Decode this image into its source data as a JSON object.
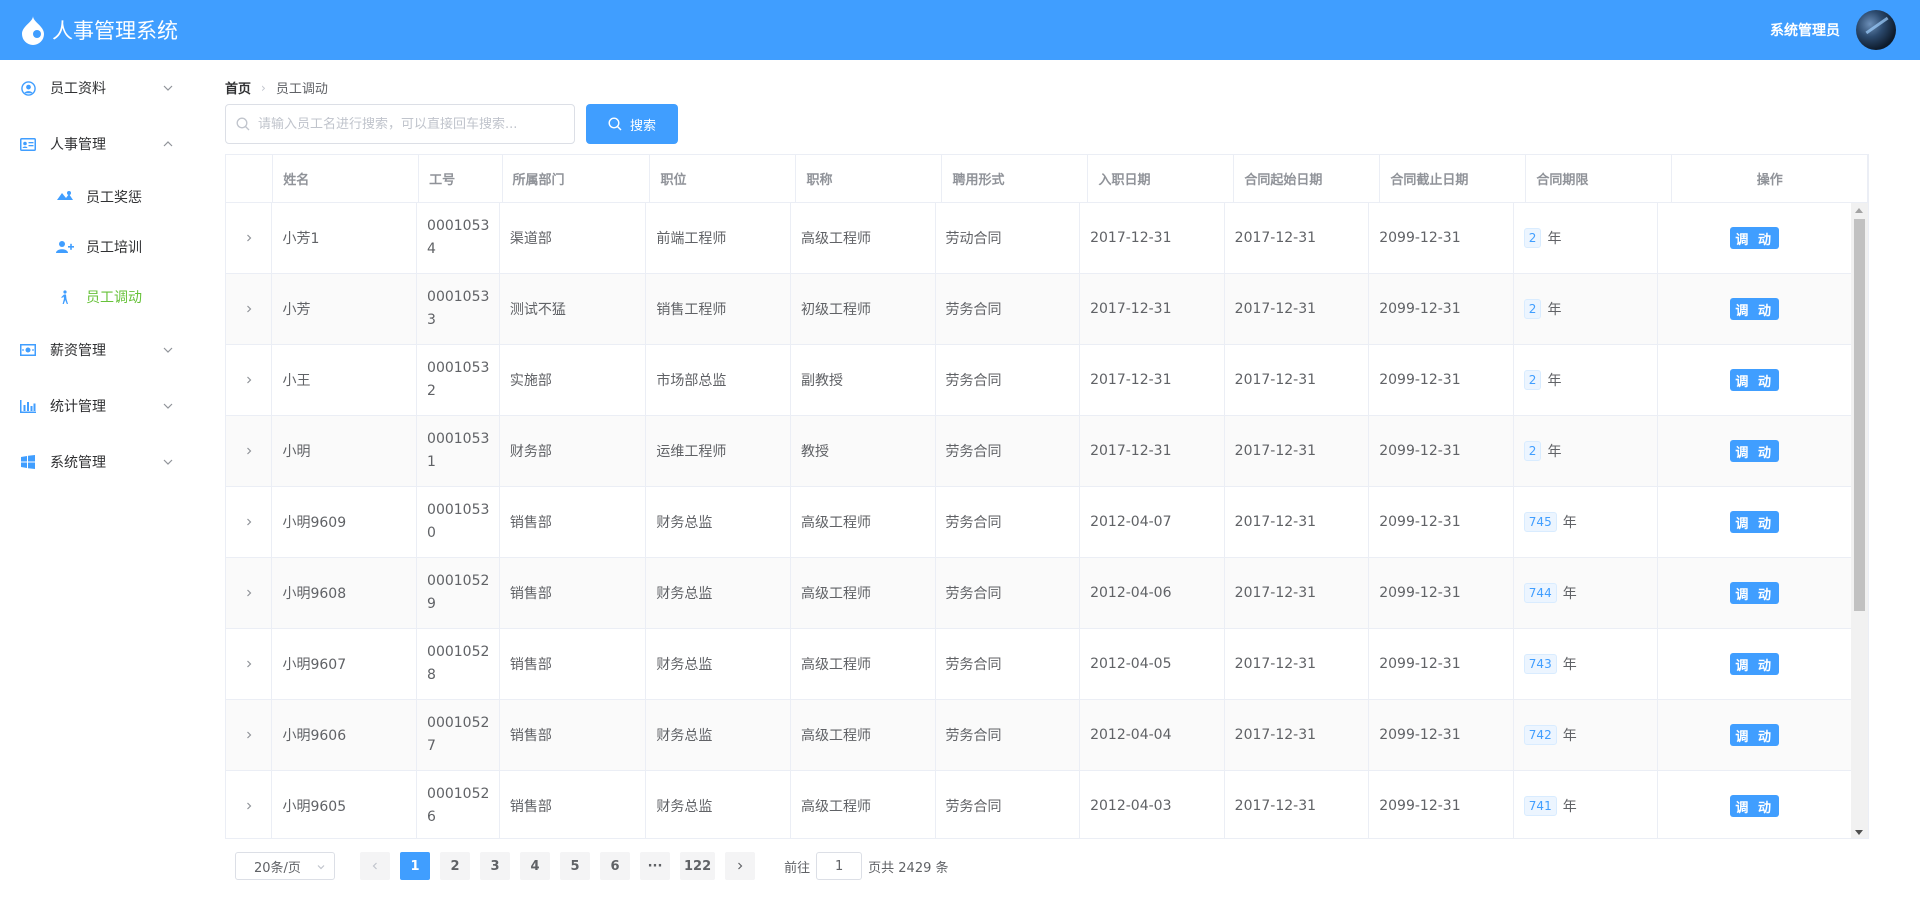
{
  "app": {
    "title": "人事管理系统",
    "user_name": "系统管理员"
  },
  "sidebar": {
    "items": [
      {
        "label": "员工资料"
      },
      {
        "label": "人事管理"
      },
      {
        "label": "薪资管理"
      },
      {
        "label": "统计管理"
      },
      {
        "label": "系统管理"
      }
    ],
    "sub_items": [
      {
        "label": "员工奖惩"
      },
      {
        "label": "员工培训"
      },
      {
        "label": "员工调动"
      }
    ]
  },
  "breadcrumb": {
    "home": "首页",
    "current": "员工调动"
  },
  "search": {
    "placeholder": "请输入员工名进行搜索，可以直接回车搜索...",
    "value": "",
    "button_label": "搜索"
  },
  "table": {
    "headers": [
      "姓名",
      "工号",
      "所属部门",
      "职位",
      "职称",
      "聘用形式",
      "入职日期",
      "合同起始日期",
      "合同截止日期",
      "合同期限",
      "操作"
    ],
    "year_unit": "年",
    "action_label": "调 动",
    "rows": [
      {
        "name": "小芳1",
        "id": "00010534",
        "dept": "渠道部",
        "position": "前端工程师",
        "title": "高级工程师",
        "employ": "劳动合同",
        "join": "2017-12-31",
        "start": "2017-12-31",
        "end": "2099-12-31",
        "term": "2"
      },
      {
        "name": "小芳",
        "id": "00010533",
        "dept": "测试不猛",
        "position": "销售工程师",
        "title": "初级工程师",
        "employ": "劳务合同",
        "join": "2017-12-31",
        "start": "2017-12-31",
        "end": "2099-12-31",
        "term": "2"
      },
      {
        "name": "小王",
        "id": "00010532",
        "dept": "实施部",
        "position": "市场部总监",
        "title": "副教授",
        "employ": "劳务合同",
        "join": "2017-12-31",
        "start": "2017-12-31",
        "end": "2099-12-31",
        "term": "2"
      },
      {
        "name": "小明",
        "id": "00010531",
        "dept": "财务部",
        "position": "运维工程师",
        "title": "教授",
        "employ": "劳务合同",
        "join": "2017-12-31",
        "start": "2017-12-31",
        "end": "2099-12-31",
        "term": "2"
      },
      {
        "name": "小明9609",
        "id": "00010530",
        "dept": "销售部",
        "position": "财务总监",
        "title": "高级工程师",
        "employ": "劳务合同",
        "join": "2012-04-07",
        "start": "2017-12-31",
        "end": "2099-12-31",
        "term": "745"
      },
      {
        "name": "小明9608",
        "id": "00010529",
        "dept": "销售部",
        "position": "财务总监",
        "title": "高级工程师",
        "employ": "劳务合同",
        "join": "2012-04-06",
        "start": "2017-12-31",
        "end": "2099-12-31",
        "term": "744"
      },
      {
        "name": "小明9607",
        "id": "00010528",
        "dept": "销售部",
        "position": "财务总监",
        "title": "高级工程师",
        "employ": "劳务合同",
        "join": "2012-04-05",
        "start": "2017-12-31",
        "end": "2099-12-31",
        "term": "743"
      },
      {
        "name": "小明9606",
        "id": "00010527",
        "dept": "销售部",
        "position": "财务总监",
        "title": "高级工程师",
        "employ": "劳务合同",
        "join": "2012-04-04",
        "start": "2017-12-31",
        "end": "2099-12-31",
        "term": "742"
      },
      {
        "name": "小明9605",
        "id": "00010526",
        "dept": "销售部",
        "position": "财务总监",
        "title": "高级工程师",
        "employ": "劳务合同",
        "join": "2012-04-03",
        "start": "2017-12-31",
        "end": "2099-12-31",
        "term": "741"
      }
    ]
  },
  "pagination": {
    "page_size_label": "20条/页",
    "pages": [
      "1",
      "2",
      "3",
      "4",
      "5",
      "6",
      "···",
      "122"
    ],
    "current_page": "1",
    "goto_prefix": "前往",
    "goto_value": "1",
    "total_text": "页共 2429 条"
  },
  "colors": {
    "primary": "#409eff",
    "active_menu": "#67c23a"
  }
}
